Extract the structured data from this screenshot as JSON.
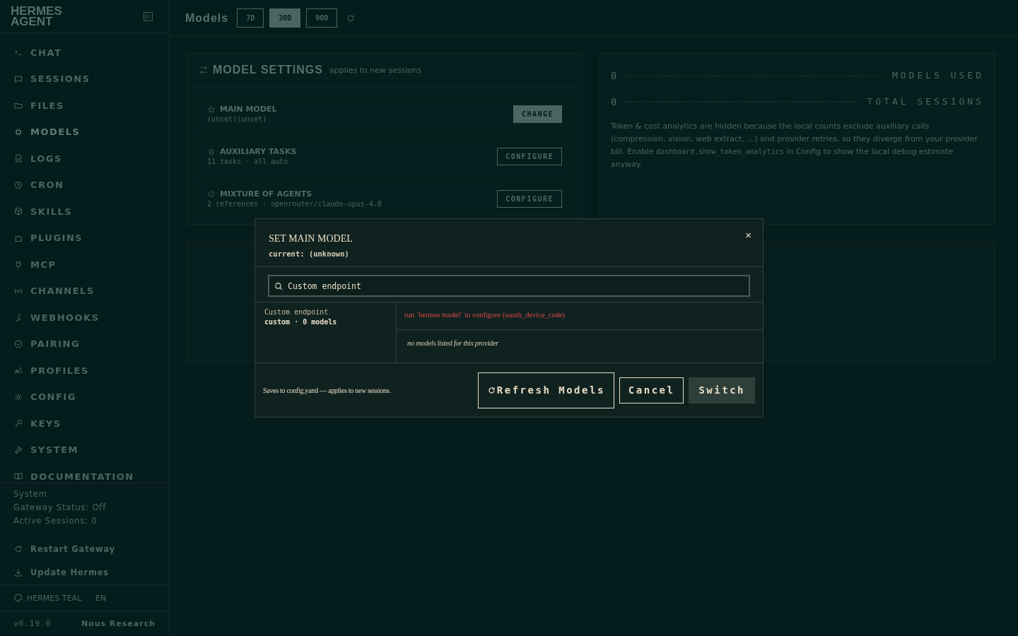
{
  "sidebar": {
    "brand": [
      "HERMES",
      "AGENT"
    ],
    "nav": [
      {
        "label": "CHAT",
        "selected": false
      },
      {
        "label": "SESSIONS",
        "selected": false
      },
      {
        "label": "FILES",
        "selected": false
      },
      {
        "label": "MODELS",
        "selected": true
      },
      {
        "label": "LOGS",
        "selected": false
      },
      {
        "label": "CRON",
        "selected": false
      },
      {
        "label": "SKILLS",
        "selected": false
      },
      {
        "label": "PLUGINS",
        "selected": false
      },
      {
        "label": "MCP",
        "selected": false
      },
      {
        "label": "CHANNELS",
        "selected": false
      },
      {
        "label": "WEBHOOKS",
        "selected": false
      },
      {
        "label": "PAIRING",
        "selected": false
      },
      {
        "label": "PROFILES",
        "selected": false
      },
      {
        "label": "CONFIG",
        "selected": false
      },
      {
        "label": "KEYS",
        "selected": false
      },
      {
        "label": "SYSTEM",
        "selected": false
      },
      {
        "label": "DOCUMENTATION",
        "selected": false
      }
    ],
    "system": {
      "heading": "System",
      "lines": [
        "Gateway Status: Off",
        "Active Sessions: 0"
      ]
    },
    "actions": [
      "Restart Gateway",
      "Update Hermes"
    ],
    "theme": "HERMES TEAL",
    "language": "EN",
    "version": "v0.19.0",
    "org": "Nous Research"
  },
  "header": {
    "title": "Models",
    "ranges": [
      {
        "label": "7D",
        "selected": false
      },
      {
        "label": "30D",
        "selected": true
      },
      {
        "label": "90D",
        "selected": false
      }
    ]
  },
  "model_settings": {
    "title": "MODEL SETTINGS",
    "subtitle": "applies to new sessions",
    "rows": [
      {
        "title": "MAIN MODEL",
        "value": "(unset)(unset)",
        "button": "CHANGE",
        "kind": "solid"
      },
      {
        "title": "AUXILIARY TASKS",
        "value": "11 tasks · all auto",
        "button": "CONFIGURE",
        "kind": "outline"
      },
      {
        "title": "MIXTURE OF AGENTS",
        "value": "2 references · openrouter/claude-opus-4.8",
        "button": "CONFIGURE",
        "kind": "outline"
      }
    ]
  },
  "stats": {
    "rows": [
      {
        "value": "0",
        "label": "MODELS USED"
      },
      {
        "value": "0",
        "label": "TOTAL SESSIONS"
      }
    ],
    "note": {
      "before": "Token & cost analytics are hidden because the local counts exclude auxiliary calls (compression, vision, web extract, …) and provider retries, so they diverge from your provider bill. Enable ",
      "code": "dashboard.show_token_analytics",
      "after": " in Config to show the local debug estimate anyway."
    }
  },
  "modal": {
    "title": "SET MAIN MODEL",
    "current": "current: (unknown)",
    "close": "×",
    "search": "Custom endpoint",
    "provider": {
      "name": "Custom endpoint",
      "meta": "custom · 0 models",
      "selected": true
    },
    "error": "run `hermes model` to configure (oauth_device_code)",
    "empty": "no models listed for this provider",
    "footer_note": "Saves to config.yaml — applies to new sessions.",
    "buttons": [
      {
        "label": "Refresh Models",
        "kind": "refresh"
      },
      {
        "label": "Cancel",
        "kind": "outline"
      },
      {
        "label": "Switch",
        "kind": "solid"
      }
    ]
  }
}
